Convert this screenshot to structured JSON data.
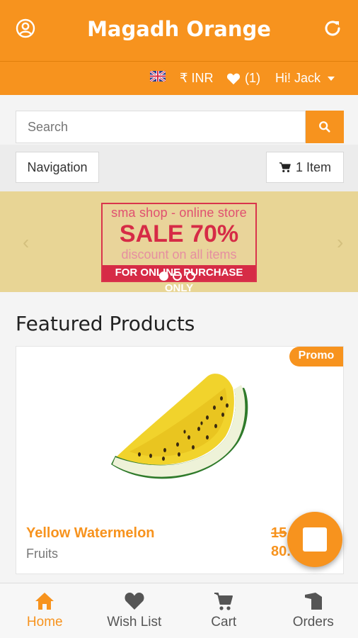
{
  "header": {
    "title": "Magadh Orange",
    "user_icon": "user-circle-icon",
    "refresh_icon": "refresh-icon"
  },
  "subbar": {
    "currency": "₹ INR",
    "wishlist_count": "(1)",
    "greeting": "Hi! Jack"
  },
  "search": {
    "placeholder": "Search"
  },
  "nav": {
    "navigation_label": "Navigation",
    "cart_label": "1 Item"
  },
  "banner": {
    "line1": "sma shop - online store",
    "line2": "SALE 70%",
    "line3": "discount on all items",
    "line4": "FOR ONLINE PURCHASE ONLY",
    "slide_count": 3,
    "active_slide": 1
  },
  "featured": {
    "title": "Featured Products",
    "products": [
      {
        "badge": "Promo",
        "name": "Yellow Watermelon",
        "category": "Fruits",
        "old_price": "15",
        "new_price": "80."
      }
    ]
  },
  "bottom_nav": {
    "items": [
      {
        "label": "Home",
        "icon": "home-icon",
        "active": true
      },
      {
        "label": "Wish List",
        "icon": "heart-icon",
        "active": false
      },
      {
        "label": "Cart",
        "icon": "cart-icon",
        "active": false
      },
      {
        "label": "Orders",
        "icon": "orders-icon",
        "active": false
      }
    ]
  },
  "colors": {
    "primary": "#f7931e",
    "banner_bg": "#e8d595",
    "sale_red": "#d62b46"
  }
}
